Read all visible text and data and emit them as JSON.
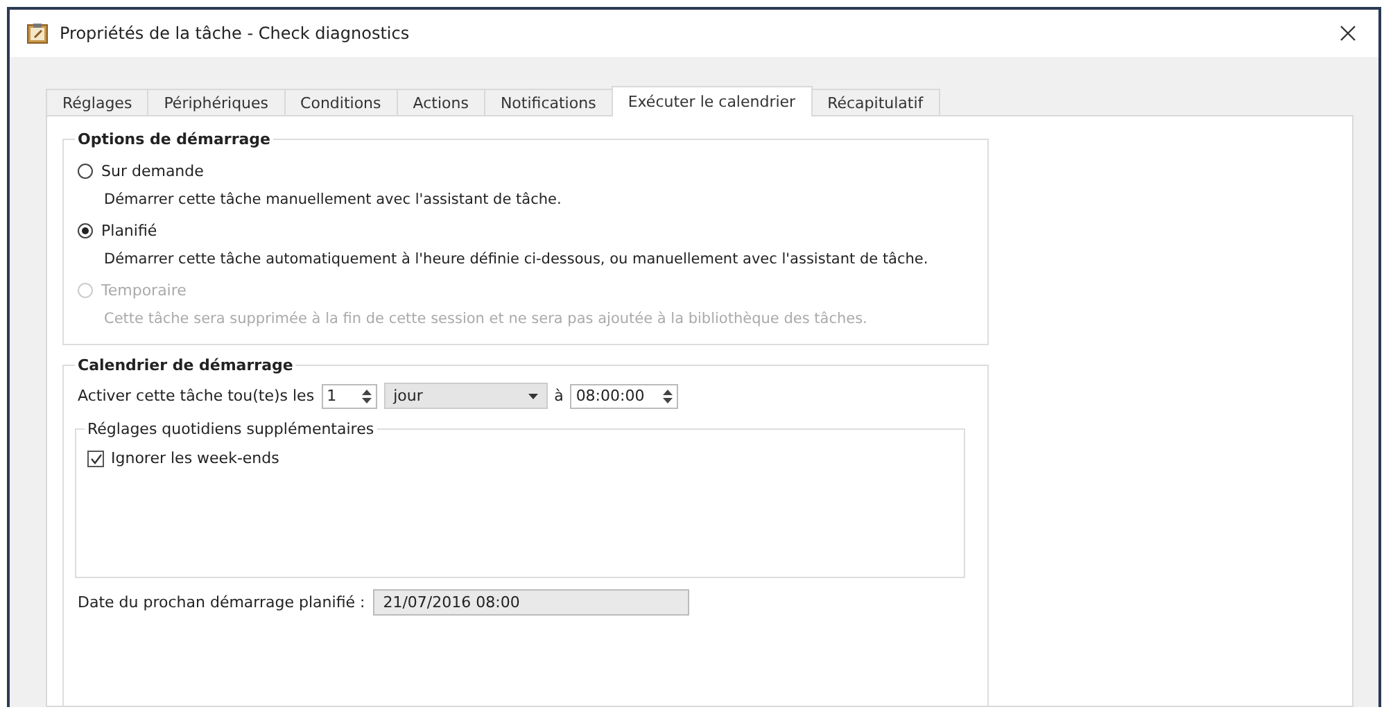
{
  "window": {
    "title": "Propriétés de la tâche - Check diagnostics"
  },
  "tabs": [
    {
      "label": "Réglages",
      "selected": false
    },
    {
      "label": "Périphériques",
      "selected": false
    },
    {
      "label": "Conditions",
      "selected": false
    },
    {
      "label": "Actions",
      "selected": false
    },
    {
      "label": "Notifications",
      "selected": false
    },
    {
      "label": "Exécuter le calendrier",
      "selected": true
    },
    {
      "label": "Récapitulatif",
      "selected": false
    }
  ],
  "startup_options": {
    "title": "Options de démarrage",
    "options": [
      {
        "label": "Sur demande",
        "description": "Démarrer cette tâche manuellement avec l'assistant de tâche.",
        "selected": false,
        "disabled": false
      },
      {
        "label": "Planifié",
        "description": "Démarrer cette tâche automatiquement à l'heure définie ci-dessous, ou manuellement avec l'assistant de tâche.",
        "selected": true,
        "disabled": false
      },
      {
        "label": "Temporaire",
        "description": "Cette tâche sera supprimée à la fin de cette session et ne sera pas ajoutée à la bibliothèque des tâches.",
        "selected": false,
        "disabled": true
      }
    ]
  },
  "schedule": {
    "title": "Calendrier de démarrage",
    "repeat_label": "Activer cette tâche tou(te)s les",
    "interval": "1",
    "unit": "jour",
    "at_label": "à",
    "time": "08:00:00",
    "daily_settings": {
      "title": "Réglages quotidiens supplémentaires",
      "checkboxes": [
        {
          "label": "Ignorer les week-ends",
          "checked": true
        }
      ]
    },
    "next_run_label": "Date du prochan démarrage planifié :",
    "next_run_value": "21/07/2016 08:00"
  }
}
